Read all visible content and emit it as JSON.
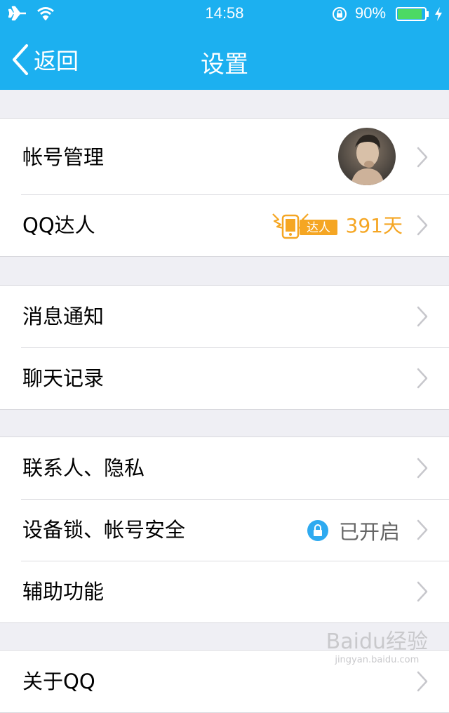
{
  "status_bar": {
    "time": "14:58",
    "battery_percent": "90%",
    "battery_level": 0.9
  },
  "nav": {
    "back_label": "返回",
    "title": "设置"
  },
  "sections": {
    "account": {
      "account_manage": "帐号管理",
      "qq_daren": "QQ达人",
      "daren_badge": "达人",
      "daren_days": "391天"
    },
    "messages": {
      "notifications": "消息通知",
      "chat_history": "聊天记录"
    },
    "privacy": {
      "contacts_privacy": "联系人、隐私",
      "device_lock": "设备锁、帐号安全",
      "device_lock_status": "已开启",
      "accessibility": "辅助功能"
    },
    "more": {
      "about_qq": "关于QQ"
    }
  },
  "watermark": {
    "brand": "Baidu经验",
    "url": "jingyan.baidu.com"
  },
  "colors": {
    "header": "#1cb0f0",
    "accent_orange": "#f5a623",
    "chevron": "#c7c7cc"
  },
  "icons": [
    "airplane-icon",
    "wifi-icon",
    "rotation-lock-icon",
    "battery-icon",
    "charging-icon",
    "back-chevron-icon",
    "chevron-right-icon",
    "lock-icon",
    "daren-wings-icon"
  ]
}
